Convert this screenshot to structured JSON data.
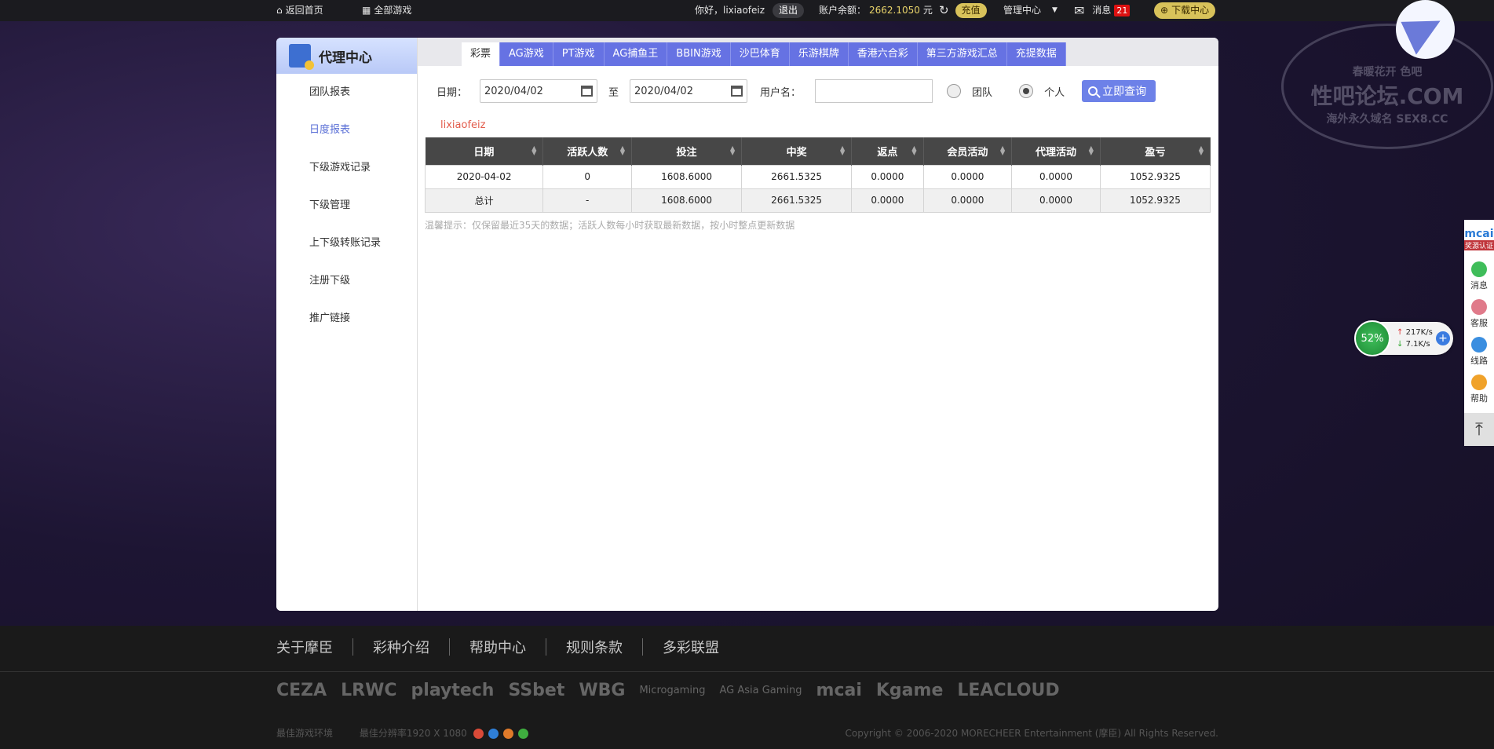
{
  "topbar": {
    "home": "返回首页",
    "all_games": "全部游戏",
    "greeting": "你好，lixiaofeiz",
    "logout": "退出",
    "balance_label": "账户余额：",
    "balance_value": "2662.1050",
    "balance_unit": "元",
    "recharge": "充值",
    "admin_center": "管理中心",
    "messages": "消息",
    "messages_count": "21",
    "download_center": "下载中心"
  },
  "sidebar": {
    "title": "代理中心",
    "items": [
      {
        "label": "团队报表"
      },
      {
        "label": "日度报表"
      },
      {
        "label": "下级游戏记录"
      },
      {
        "label": "下级管理"
      },
      {
        "label": "上下级转账记录"
      },
      {
        "label": "注册下级"
      },
      {
        "label": "推广链接"
      }
    ],
    "active_index": 1
  },
  "tabs": [
    {
      "label": "彩票"
    },
    {
      "label": "AG游戏"
    },
    {
      "label": "PT游戏"
    },
    {
      "label": "AG捕鱼王"
    },
    {
      "label": "BBIN游戏"
    },
    {
      "label": "沙巴体育"
    },
    {
      "label": "乐游棋牌"
    },
    {
      "label": "香港六合彩"
    },
    {
      "label": "第三方游戏汇总"
    },
    {
      "label": "充提数据"
    }
  ],
  "filter": {
    "date_label": "日期：",
    "date_from": "2020/04/02",
    "to_label": "至",
    "date_to": "2020/04/02",
    "username_label": "用户名：",
    "username_value": "",
    "team_label": "团队",
    "personal_label": "个人",
    "selected_scope": "个人",
    "query_button": "立即查询"
  },
  "report": {
    "username": "lixiaofeiz",
    "columns": [
      "日期",
      "活跃人数",
      "投注",
      "中奖",
      "返点",
      "会员活动",
      "代理活动",
      "盈亏"
    ],
    "rows": [
      [
        "2020-04-02",
        "0",
        "1608.6000",
        "2661.5325",
        "0.0000",
        "0.0000",
        "0.0000",
        "1052.9325"
      ],
      [
        "总计",
        "-",
        "1608.6000",
        "2661.5325",
        "0.0000",
        "0.0000",
        "0.0000",
        "1052.9325"
      ]
    ],
    "tip": "温馨提示：仅保留最近35天的数据；活跃人数每小时获取最新数据，按小时整点更新数据"
  },
  "footer": {
    "links": [
      "关于摩臣",
      "彩种介绍",
      "帮助中心",
      "规则条款",
      "多彩联盟"
    ],
    "logos": [
      "CEZA",
      "LRWC",
      "playtech",
      "SSbet",
      "WBG",
      "Microgaming",
      "AG Asia Gaming",
      "mcai",
      "Kgame",
      "LEACLOUD"
    ],
    "env_label": "最佳游戏环境",
    "resolution": "最佳分辨率1920 X 1080",
    "copyright": "Copyright © 2006-2020 MORECHEER Entertainment (摩臣) All Rights Reserved."
  },
  "rightbar": {
    "mcai_logo": "mcai",
    "mcai_sub": "奖源认证",
    "items": [
      {
        "label": "消息",
        "icon": "chat-icon",
        "color": "#3fbd5a"
      },
      {
        "label": "客服",
        "icon": "service-icon",
        "color": "#e07a8a"
      },
      {
        "label": "线路",
        "icon": "route-icon",
        "color": "#3a8ee0"
      },
      {
        "label": "帮助",
        "icon": "help-icon",
        "color": "#f0a22a"
      }
    ],
    "to_top": "⤒"
  },
  "network": {
    "percent": "52%",
    "upload": "217K/s",
    "download": "7.1K/s"
  },
  "watermark": {
    "top": "春暖花开 色吧",
    "main": "性吧论坛.COM",
    "sub": "海外永久域名 SEX8.CC"
  }
}
